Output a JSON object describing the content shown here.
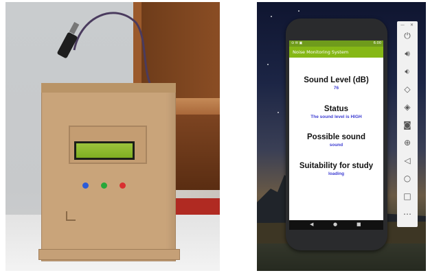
{
  "emulator": {
    "app_title": "Noise Monitoring System",
    "status_time": "6:00",
    "sections": [
      {
        "label": "Sound Level (dB)",
        "value": "76"
      },
      {
        "label": "Status",
        "value": "The sound level is HIGH"
      },
      {
        "label": "Possible sound",
        "value": "sound"
      },
      {
        "label": "Suitability for study",
        "value": "loading"
      }
    ],
    "nav_icons": [
      "back-icon",
      "home-icon",
      "recents-icon"
    ],
    "toolbar": {
      "window_controls": [
        "minimize-icon",
        "close-icon"
      ],
      "icons": [
        "power-icon",
        "volume-up-icon",
        "volume-down-icon",
        "rotate-left-icon",
        "rotate-right-icon",
        "camera-icon",
        "zoom-icon",
        "back-icon",
        "home-icon",
        "overview-icon",
        "more-icon"
      ]
    },
    "accent_color": "#86b816",
    "value_color": "#3c3cd2"
  }
}
